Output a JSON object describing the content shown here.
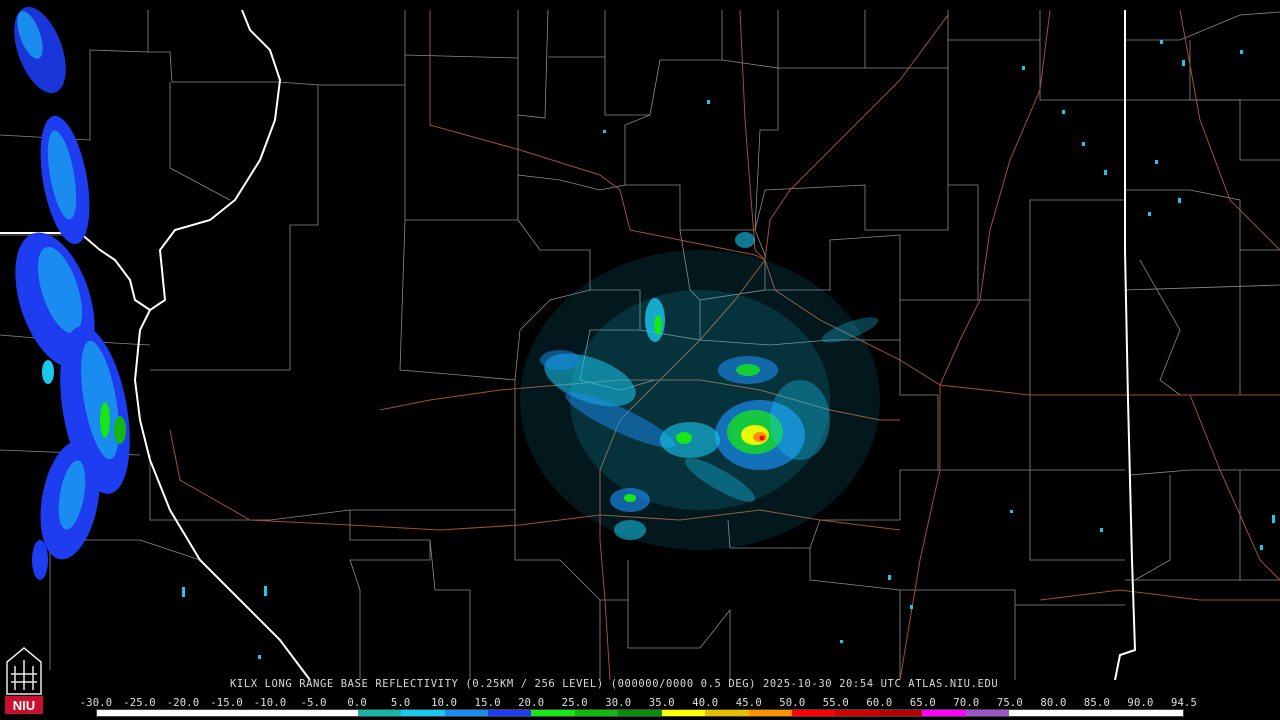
{
  "product_title": "KILX LONG RANGE BASE REFLECTIVITY (0.25KM / 256 LEVEL) (000000/0000 0.5 DEG) 2025-10-30 20:54 UTC  ATLAS.NIU.EDU",
  "logo_text": "NIU",
  "scale": {
    "labels": [
      "-30.0",
      "-25.0",
      "-20.0",
      "-15.0",
      "-10.0",
      "-5.0",
      "0.0",
      "5.0",
      "10.0",
      "15.0",
      "20.0",
      "25.0",
      "30.0",
      "35.0",
      "40.0",
      "45.0",
      "50.0",
      "55.0",
      "60.0",
      "65.0",
      "70.0",
      "75.0",
      "80.0",
      "85.0",
      "90.0",
      "94.5"
    ],
    "colors": [
      "#ffffff",
      "#ffffff",
      "#ffffff",
      "#ffffff",
      "#ffffff",
      "#ffffff",
      "#1ab3a6",
      "#19c8f0",
      "#1a8cf0",
      "#1e3cf0",
      "#17e617",
      "#12b812",
      "#0c8c0c",
      "#ffff00",
      "#e6c000",
      "#ff9000",
      "#ff0000",
      "#d20000",
      "#b00000",
      "#ff00ff",
      "#9a55c9",
      "#ffffff",
      "#ffffff",
      "#ffffff",
      "#ffffff"
    ]
  },
  "colors": {
    "background": "#000000",
    "county_lines": "#8a8a8a",
    "state_lines": "#ffffff",
    "roads": "#a0522d"
  }
}
